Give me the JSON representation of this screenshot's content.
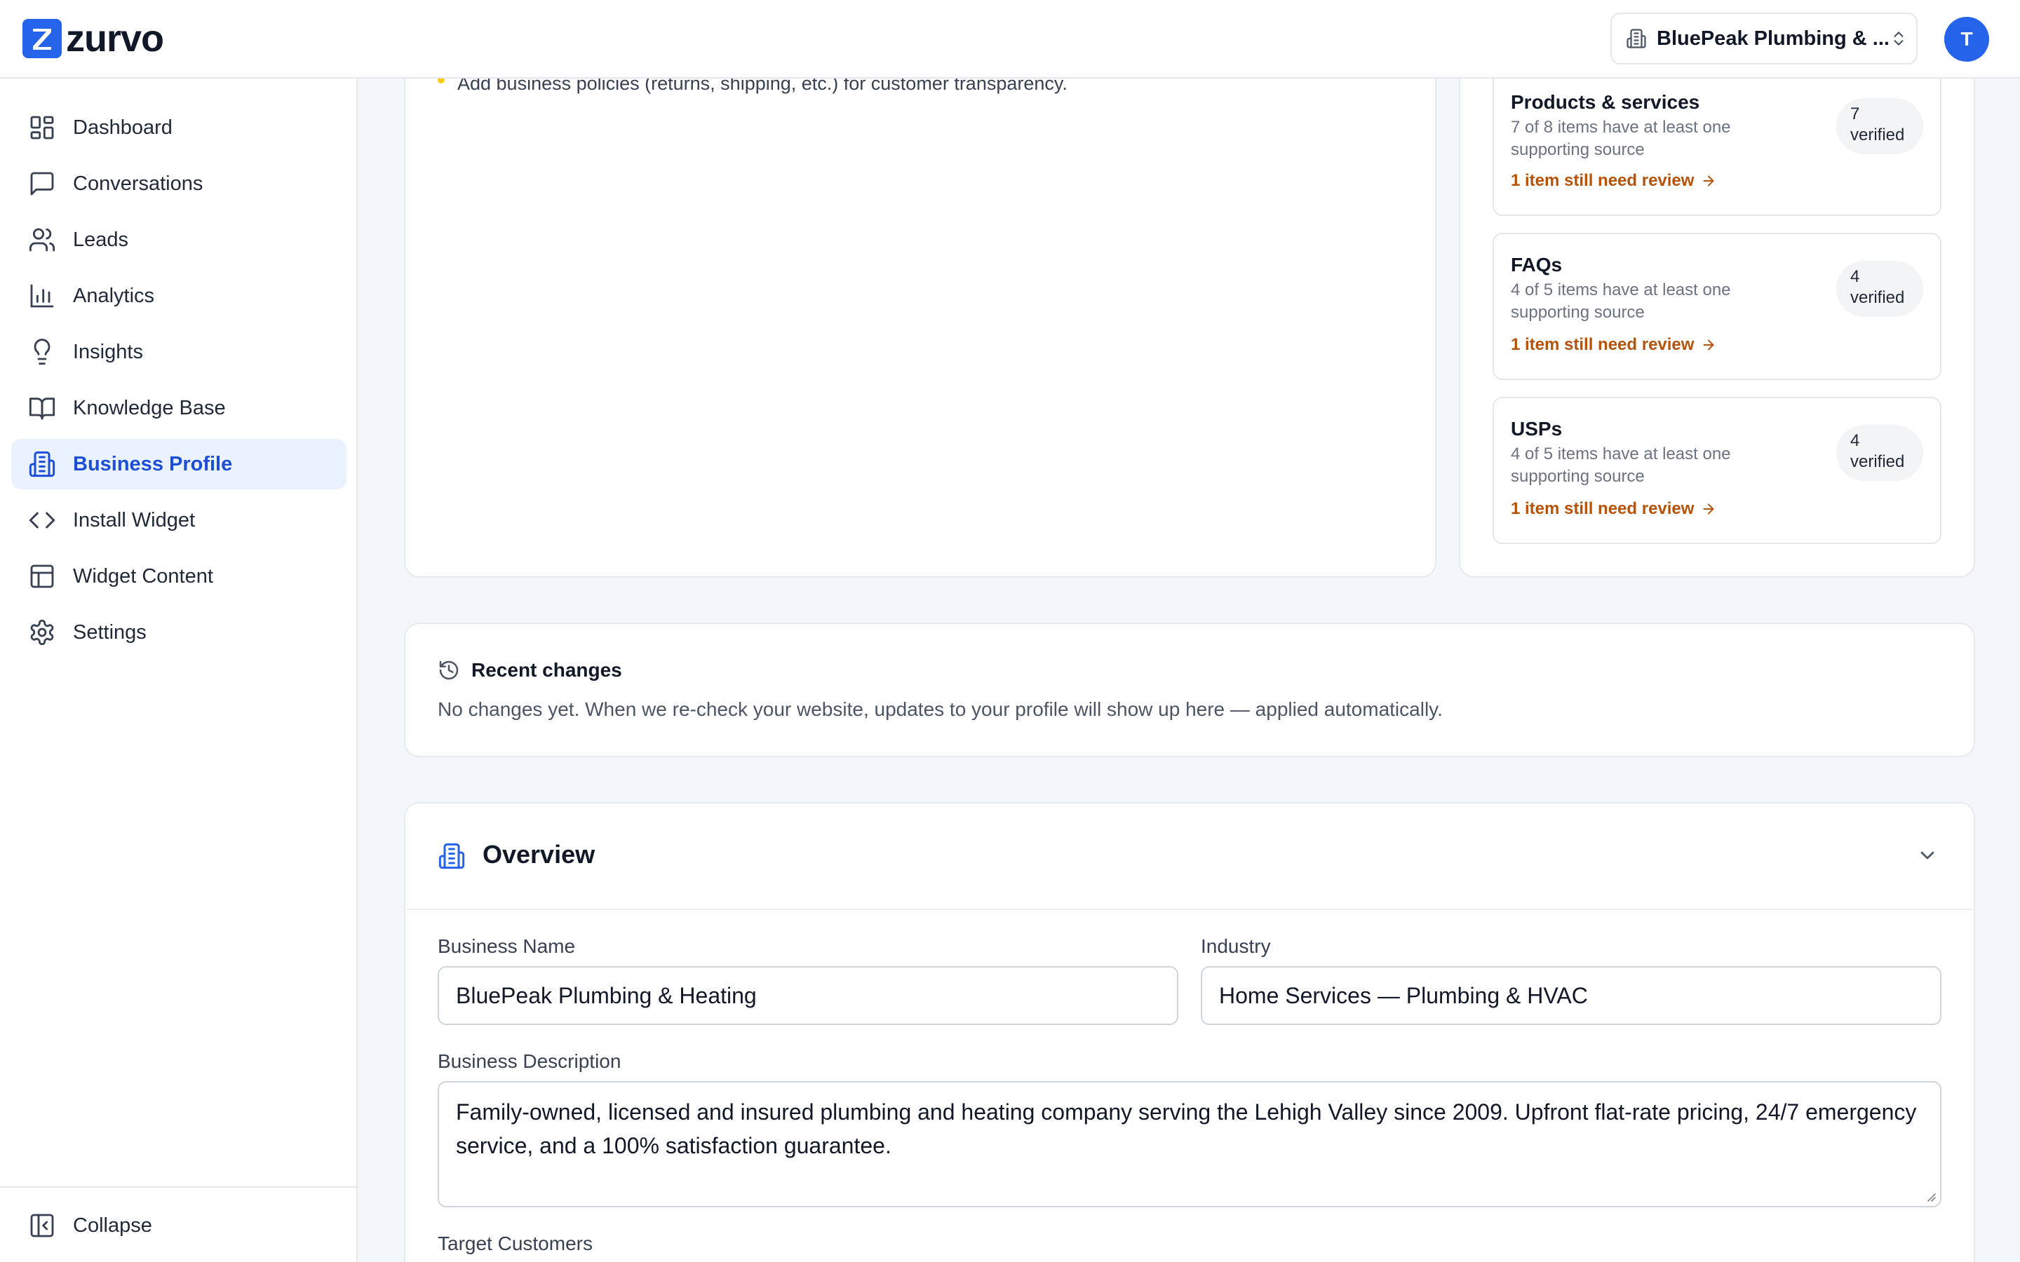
{
  "app": {
    "logo_text": "zurvo",
    "logo_letter": "Z",
    "business_switcher": "BluePeak Plumbing & ...",
    "avatar_initial": "T"
  },
  "sidebar": {
    "items": [
      {
        "label": "Dashboard",
        "icon": "dashboard-icon"
      },
      {
        "label": "Conversations",
        "icon": "chat-icon"
      },
      {
        "label": "Leads",
        "icon": "users-icon"
      },
      {
        "label": "Analytics",
        "icon": "bar-chart-icon"
      },
      {
        "label": "Insights",
        "icon": "lightbulb-icon"
      },
      {
        "label": "Knowledge Base",
        "icon": "book-icon"
      },
      {
        "label": "Business Profile",
        "icon": "building-icon",
        "active": true
      },
      {
        "label": "Install Widget",
        "icon": "code-icon"
      },
      {
        "label": "Widget Content",
        "icon": "layout-icon"
      },
      {
        "label": "Settings",
        "icon": "gear-icon"
      }
    ],
    "collapse_label": "Collapse"
  },
  "suggestions": {
    "last_item": "Add business policies (returns, shipping, etc.) for customer transparency."
  },
  "sources": [
    {
      "title": "Products & services",
      "subtitle": "7 of 8 items have at least one supporting source",
      "verified_count": "7",
      "verified_label": "verified",
      "review": "1 item still need review"
    },
    {
      "title": "FAQs",
      "subtitle": "4 of 5 items have at least one supporting source",
      "verified_count": "4",
      "verified_label": "verified",
      "review": "1 item still need review"
    },
    {
      "title": "USPs",
      "subtitle": "4 of 5 items have at least one supporting source",
      "verified_count": "4",
      "verified_label": "verified",
      "review": "1 item still need review"
    }
  ],
  "recent_changes": {
    "title": "Recent changes",
    "text": "No changes yet. When we re-check your website, updates to your profile will show up here — applied automatically."
  },
  "overview": {
    "title": "Overview",
    "business_name_label": "Business Name",
    "business_name": "BluePeak Plumbing & Heating",
    "industry_label": "Industry",
    "industry": "Home Services — Plumbing & HVAC",
    "description_label": "Business Description",
    "description": "Family-owned, licensed and insured plumbing and heating company serving the Lehigh Valley since 2009. Upfront flat-rate pricing, 24/7 emergency service, and a 100% satisfaction guarantee.",
    "target_customers_label": "Target Customers"
  },
  "colors": {
    "accent": "#2563eb",
    "active_bg": "#eaf2fe",
    "warning_text": "#b45309",
    "bullet": "#facc15"
  }
}
